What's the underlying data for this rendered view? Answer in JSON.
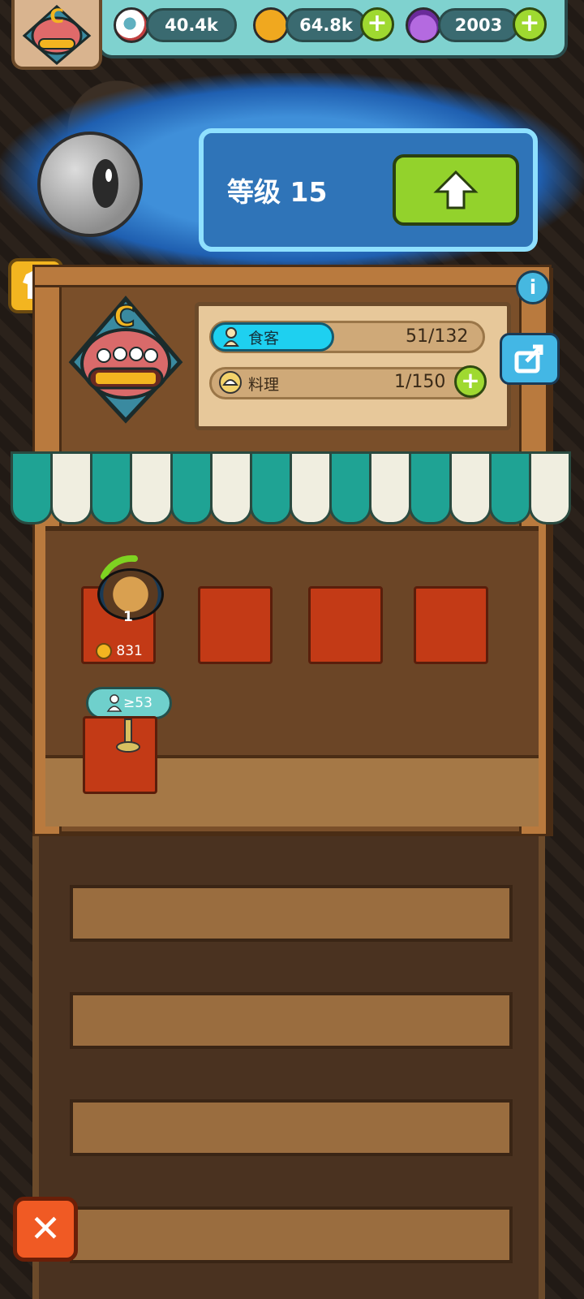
{
  "topbar": {
    "eye_amount": "40.4k",
    "coin_amount": "64.8k",
    "potion_amount": "2003",
    "plus_symbol": "+"
  },
  "level": {
    "text": "等级 15",
    "upgrade_icon": "arrow-up-icon"
  },
  "shop": {
    "emblem_letter": "C",
    "customers_label": "食客",
    "customers_value": "51/132",
    "cooking_label": "料理",
    "cooking_value": "1/150",
    "info_symbol": "i",
    "share_icon": "share-icon"
  },
  "tables": {
    "dish_count": "1",
    "earnings": "831",
    "unlock_requirement": "≥53"
  },
  "buttons": {
    "close_symbol": "✕"
  },
  "colors": {
    "accent_green": "#93d22c",
    "panel_blue": "#2f74b8",
    "wood": "#7a4f2a",
    "awning_teal": "#1fa394",
    "awning_white": "#f0eee0",
    "table_red": "#c33a16",
    "close_orange": "#f05a24"
  }
}
